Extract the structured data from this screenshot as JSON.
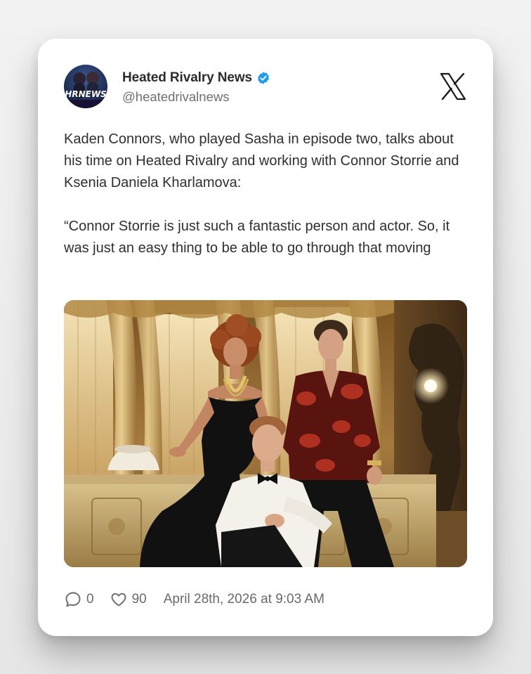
{
  "tweet": {
    "author": {
      "display_name": "Heated Rivalry News",
      "handle": "@heatedrivalnews",
      "verified": true,
      "avatar_overlay_text": "HRNEWS"
    },
    "platform_icon": "x-logo-icon",
    "text_paragraphs": [
      "Kaden Connors, who played Sasha in episode two, talks about his time on Heated Rivalry and working with Connor Storrie and Ksenia Daniela Kharlamova:",
      "“Connor Storrie is just such a fantastic person and actor. So, it was just an easy thing to be able to go through that moving"
    ],
    "media": {
      "type": "photo",
      "subject_count": 3
    },
    "stats": {
      "replies": "0",
      "likes": "90"
    },
    "timestamp": "April 28th, 2026 at 9:03 AM"
  },
  "colors": {
    "verified_badge": "#1d9bf0",
    "text": "#2f2f2f",
    "muted": "#6f6f6f",
    "card_background": "#ffffff"
  },
  "icons": {
    "reply": "speech-bubble-icon",
    "like": "heart-icon",
    "verified": "verified-badge-icon"
  }
}
